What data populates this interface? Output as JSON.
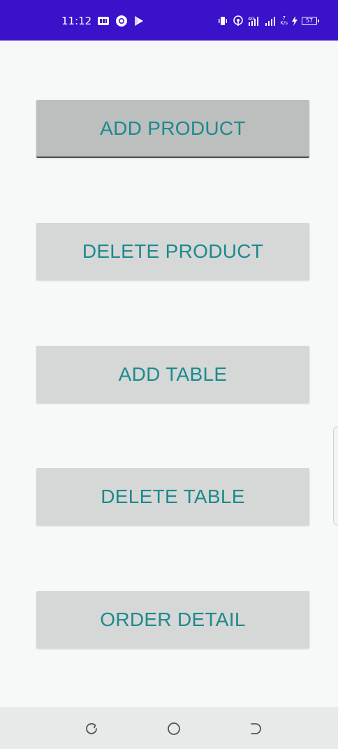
{
  "status_bar": {
    "time": "11:12",
    "net_speed_value": "7",
    "net_speed_unit": "K/s",
    "battery_level": "57",
    "colors": {
      "background": "#3a12c9",
      "foreground": "#ffffff"
    },
    "left_icons": [
      "screen-record-icon",
      "chrome-icon",
      "play-store-icon"
    ],
    "right_icons": [
      "vibrate-icon",
      "hotspot-icon",
      "volte-signal-icon",
      "signal-bars-icon",
      "net-speed",
      "battery-icon"
    ]
  },
  "menu": {
    "buttons": [
      {
        "label": "ADD PRODUCT",
        "focused": true
      },
      {
        "label": "DELETE PRODUCT",
        "focused": false
      },
      {
        "label": "ADD TABLE",
        "focused": false
      },
      {
        "label": "DELETE TABLE",
        "focused": false
      },
      {
        "label": "ORDER DETAIL",
        "focused": false
      }
    ],
    "colors": {
      "button_text": "#1d8a8c",
      "button_bg": "#d6d7d7",
      "button_focused_bg": "#bdbebe"
    }
  },
  "nav_bar": {
    "icons": [
      "recents-icon",
      "home-icon",
      "back-icon"
    ]
  }
}
